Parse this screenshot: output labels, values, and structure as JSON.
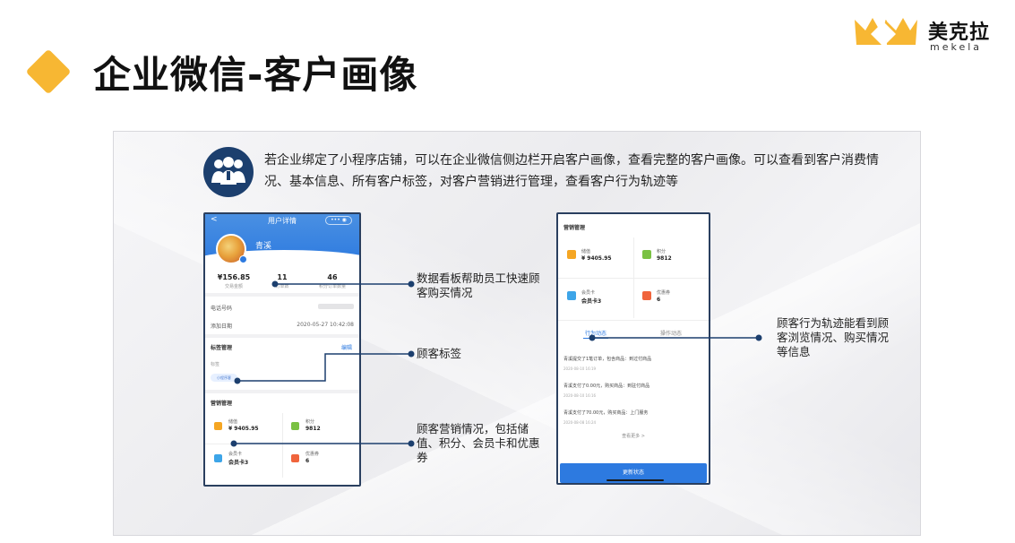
{
  "header": {
    "title": "企业微信-客户画像",
    "accent_color": "#f7b733"
  },
  "logo": {
    "name_cn": "美克拉",
    "name_en": "mekela",
    "color": "#f7b733"
  },
  "intro": {
    "text": "若企业绑定了小程序店铺，可以在企业微信侧边栏开启客户画像，查看完整的客户画像。可以查看到客户消费情况、基本信息、所有客户标签，对客户营销进行管理，查看客户行为轨迹等"
  },
  "phone1": {
    "nav_title": "用户详情",
    "back": "<",
    "capsule": "••• ◉",
    "user_name": "青溪",
    "stats": [
      {
        "value": "¥156.85",
        "label": "交易金额"
      },
      {
        "value": "11",
        "label": "订单数"
      },
      {
        "value": "46",
        "label": "积分订单数量"
      }
    ],
    "rows": [
      {
        "label": "电话号码",
        "value": ""
      },
      {
        "label": "添加日期",
        "value": "2020-05-27 10:42:08"
      }
    ],
    "tags_section": {
      "title": "标签管理",
      "edit": "编辑",
      "sub": "标签",
      "tag": "小程序客"
    },
    "marketing": {
      "title": "营销管理",
      "cells": [
        {
          "label": "储值",
          "value": "¥ 9405.95",
          "color": "#f5a623"
        },
        {
          "label": "积分",
          "value": "9812",
          "color": "#7ac143"
        },
        {
          "label": "会员卡",
          "value": "会员卡3",
          "color": "#3da5e8"
        },
        {
          "label": "优惠券",
          "value": "6",
          "color": "#f0643c"
        }
      ]
    }
  },
  "phone2": {
    "title": "营销管理",
    "cells": [
      {
        "label": "储值",
        "value": "¥ 9405.95",
        "color": "#f5a623"
      },
      {
        "label": "积分",
        "value": "9812",
        "color": "#7ac143"
      },
      {
        "label": "会员卡",
        "value": "会员卡3",
        "color": "#3da5e8"
      },
      {
        "label": "优惠券",
        "value": "6",
        "color": "#f0643c"
      }
    ],
    "tabs": [
      {
        "label": "行为动态",
        "active": true
      },
      {
        "label": "操作动态",
        "active": false
      }
    ],
    "activities": [
      {
        "text": "青溪提交了1笔订单，包含商品：到过付商品",
        "time": "2020-08-10 16:19"
      },
      {
        "text": "青溪支付了0.00元，购买商品：到驻付商品",
        "time": "2020-08-10 16:16"
      },
      {
        "text": "青溪支付了70.00元，购买商品：上门服务",
        "time": "2020-08-08 16:24"
      }
    ],
    "more": "查看更多 >",
    "button": "更新状态"
  },
  "callouts": {
    "data_board": "数据看板帮助员工快速顾客购买情况",
    "tags": "顾客标签",
    "marketing": "顾客营销情况，包括储值、积分、会员卡和优惠券",
    "behavior": "顾客行为轨迹能看到顾客浏览情况、购买情况等信息"
  }
}
